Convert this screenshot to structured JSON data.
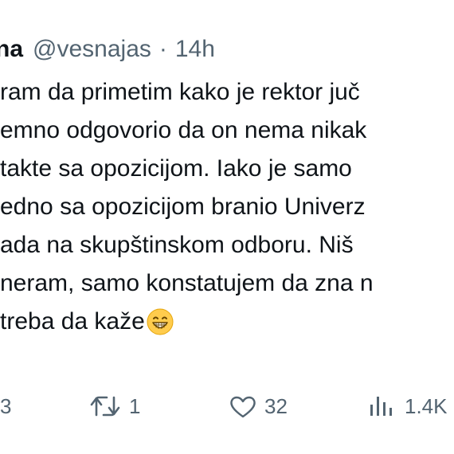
{
  "author": {
    "display_name_visible": "na",
    "handle": "@vesnajas",
    "separator": "·",
    "time": "14h"
  },
  "tweet": {
    "lines": [
      "ram da primetim kako je rektor juč",
      "emno odgovorio da on nema nikak",
      "takte sa opozicijom. Iako je samo",
      "edno sa opozicijom branio Univerz",
      "ada na skupštinskom odboru. Niš",
      "neram, samo konstatujem da zna n",
      "treba da kaže"
    ],
    "emoji": "grinning-face-with-smiling-eyes"
  },
  "actions": {
    "reply_count": "3",
    "retweet_count": "1",
    "like_count": "32",
    "views_count": "1.4K"
  },
  "colors": {
    "text": "#0f1419",
    "secondary": "#536471",
    "emoji_face": "#ffcc4d"
  }
}
